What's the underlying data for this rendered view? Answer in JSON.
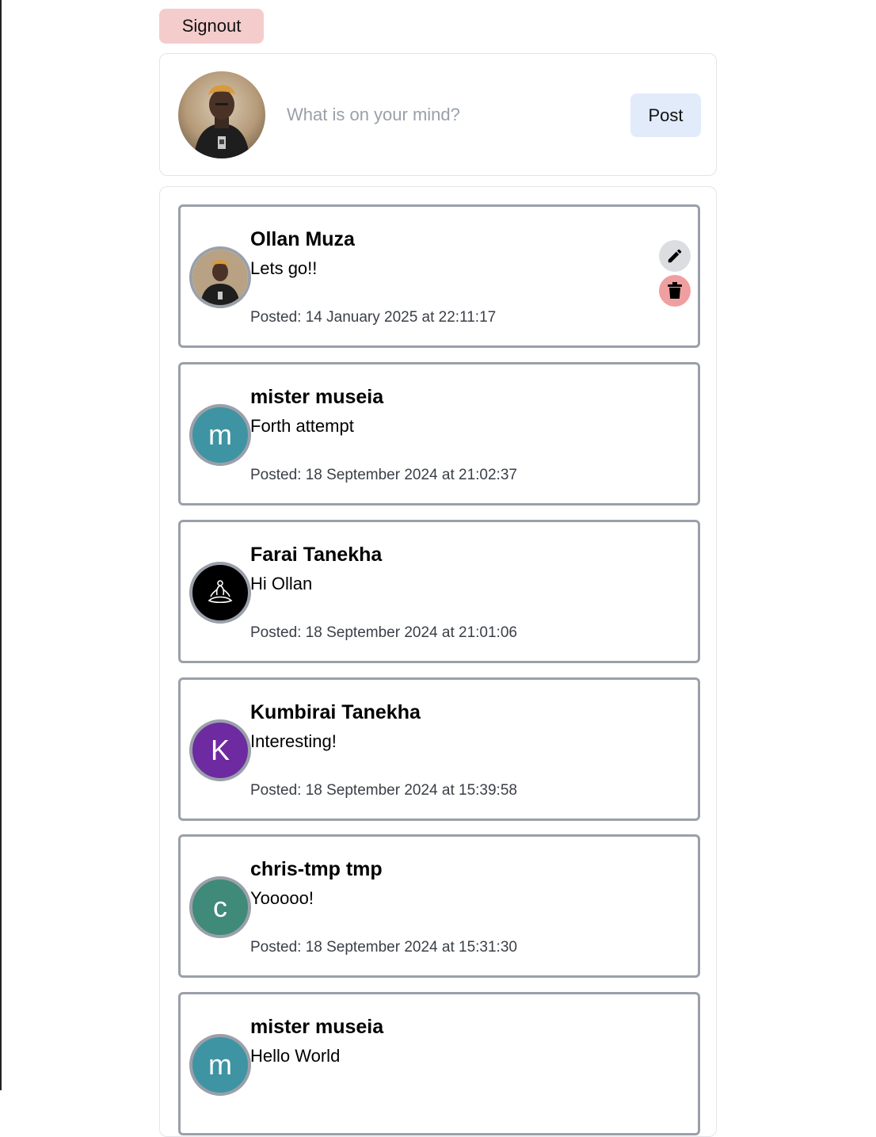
{
  "header": {
    "signout_label": "Signout"
  },
  "composer": {
    "placeholder": "What is on your mind?",
    "value": "",
    "post_label": "Post"
  },
  "posts": [
    {
      "author": "Ollan Muza",
      "body": "Lets go!!",
      "time": "Posted: 14 January 2025 at 22:11:17",
      "avatar": "photo",
      "owned": true
    },
    {
      "author": "mister museia",
      "body": "Forth attempt",
      "time": "Posted: 18 September 2024 at 21:02:37",
      "avatar": "initial",
      "initial": "m",
      "avatar_color": "#3e94a3"
    },
    {
      "author": "Farai Tanekha",
      "body": "Hi Ollan",
      "time": "Posted: 18 September 2024 at 21:01:06",
      "avatar": "meditation-icon"
    },
    {
      "author": "Kumbirai Tanekha",
      "body": "Interesting!",
      "time": "Posted: 18 September 2024 at 15:39:58",
      "avatar": "initial",
      "initial": "K",
      "avatar_color": "#6e2aa1"
    },
    {
      "author": "chris-tmp tmp",
      "body": "Yooooo!",
      "time": "Posted: 18 September 2024 at 15:31:30",
      "avatar": "initial",
      "initial": "c",
      "avatar_color": "#3f8a78"
    },
    {
      "author": "mister museia",
      "body": "Hello World",
      "time": "",
      "avatar": "initial",
      "initial": "m",
      "avatar_color": "#3e94a3"
    }
  ],
  "icons": {
    "edit": "pencil-icon",
    "delete": "trash-icon"
  }
}
